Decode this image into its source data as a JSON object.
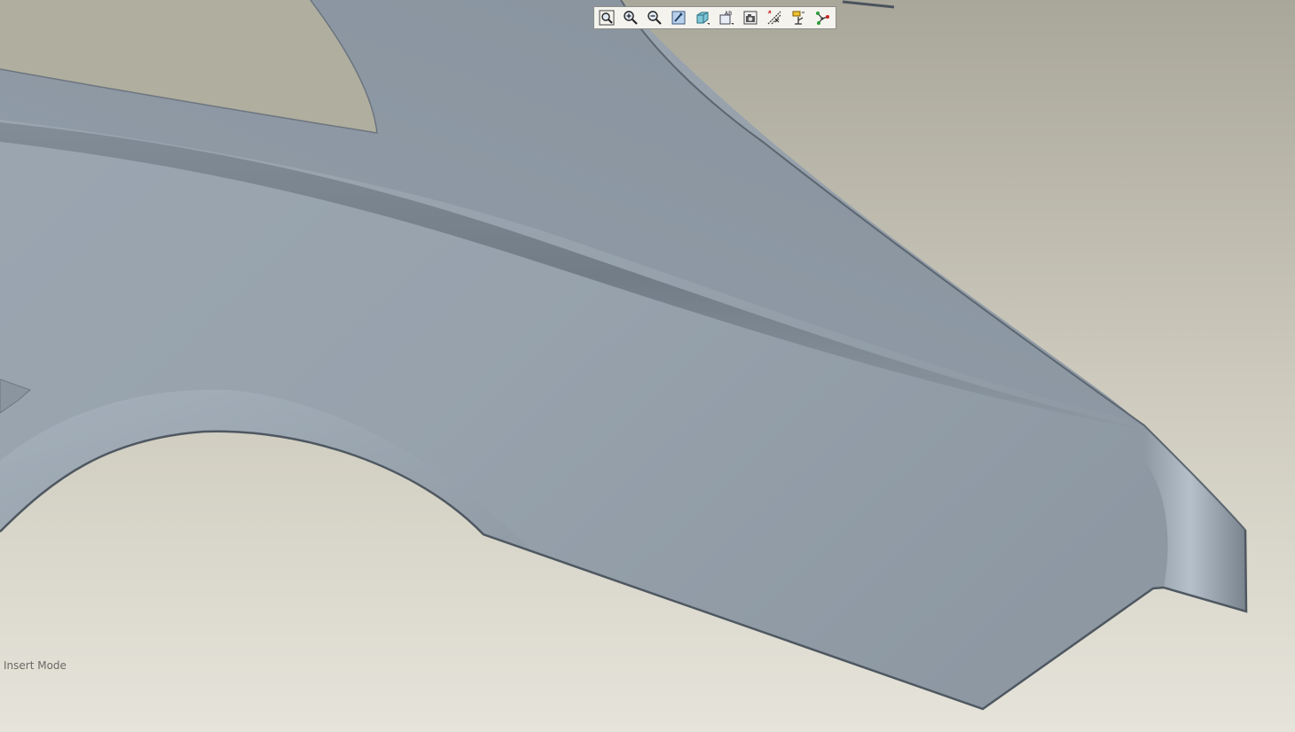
{
  "colors": {
    "background_top": "#a9a79a",
    "background_bottom": "#e6e4da",
    "model_surface": "#98a3ad",
    "model_edge": "#57606a",
    "toolbar_background": "#f4f3ee"
  },
  "view_toolbar": {
    "buttons": [
      {
        "name": "zoom-fit-button",
        "icon": "magnifier-frame-icon"
      },
      {
        "name": "zoom-in-button",
        "icon": "magnifier-plus-icon"
      },
      {
        "name": "zoom-out-button",
        "icon": "magnifier-minus-icon"
      },
      {
        "name": "repaint-button",
        "icon": "repaint-icon"
      },
      {
        "name": "display-style-button",
        "icon": "shaded-cube-icon"
      },
      {
        "name": "saved-views-button",
        "icon": "named-views-icon"
      },
      {
        "name": "view-manager-button",
        "icon": "camera-icon"
      },
      {
        "name": "datum-planes-button",
        "icon": "datum-planes-icon"
      },
      {
        "name": "datum-csys-button",
        "icon": "coordinate-system-icon"
      },
      {
        "name": "datum-points-button",
        "icon": "datum-points-icon"
      }
    ]
  },
  "status": {
    "mode_text": "Insert Mode"
  }
}
